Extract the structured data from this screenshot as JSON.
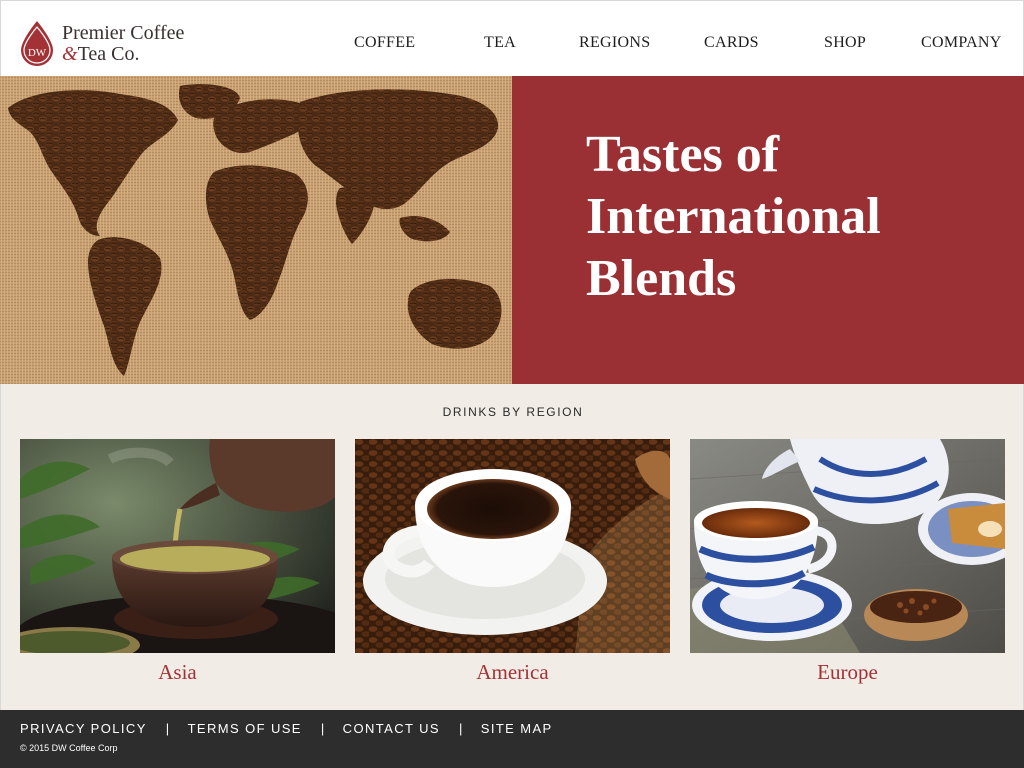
{
  "brand": {
    "monogram": "DW",
    "name_line1": "Premier Coffee",
    "name_amp": "&",
    "name_line2": "Tea Co."
  },
  "nav": {
    "items": [
      {
        "label": "COFFEE"
      },
      {
        "label": "TEA"
      },
      {
        "label": "REGIONS"
      },
      {
        "label": "CARDS"
      },
      {
        "label": "SHOP"
      },
      {
        "label": "COMPANY"
      }
    ]
  },
  "hero": {
    "title": "Tastes of International Blends",
    "image_subject": "world map made of coffee beans on burlap"
  },
  "regions": {
    "heading": "DRINKS BY REGION",
    "cards": [
      {
        "label": "Asia",
        "image_subject": "green tea poured from clay teapot into cup"
      },
      {
        "label": "America",
        "image_subject": "cup of black coffee with scattered coffee beans"
      },
      {
        "label": "Europe",
        "image_subject": "blue willow porcelain teacup and teapot"
      }
    ]
  },
  "footer": {
    "links": [
      {
        "label": "PRIVACY POLICY"
      },
      {
        "label": "TERMS OF USE"
      },
      {
        "label": "CONTACT US"
      },
      {
        "label": "SITE MAP"
      }
    ],
    "separator": "|",
    "copyright": "© 2015 DW Coffee Corp"
  },
  "colors": {
    "brand_red": "#9a3034",
    "label_red": "#a33237",
    "section_bg": "#f1ede6",
    "footer_bg": "#2d2d2d"
  }
}
